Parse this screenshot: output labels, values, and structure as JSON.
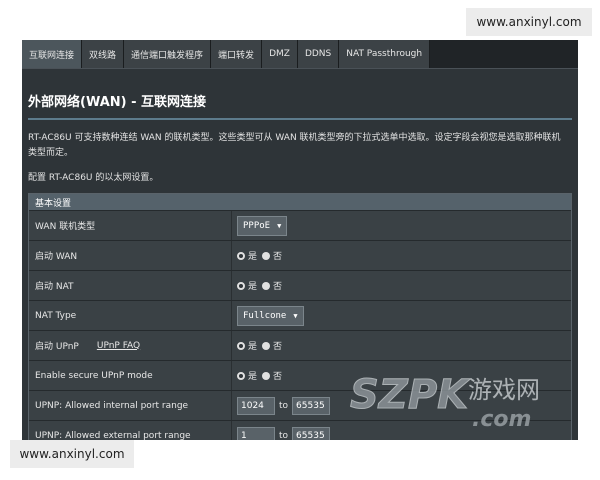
{
  "watermark_top": "www.anxinyl.com",
  "watermark_bottom": "www.anxinyl.com",
  "tabs": [
    "互联网连接",
    "双线路",
    "通信端口触发程序",
    "端口转发",
    "DMZ",
    "DDNS",
    "NAT Passthrough"
  ],
  "page_title": "外部网络(WAN) - 互联网连接",
  "description": "RT-AC86U 可支持数种连结 WAN 的联机类型。这些类型可从 WAN 联机类型旁的下拉式选单中选取。设定字段会视您是选取那种联机类型而定。",
  "config_text": "配置 RT-AC86U 的以太网设置。",
  "section_title": "基本设置",
  "rows": {
    "wan_type": {
      "label": "WAN 联机类型",
      "value": "PPPoE"
    },
    "enable_wan": {
      "label": "启动 WAN",
      "yes": "是",
      "no": "否"
    },
    "enable_nat": {
      "label": "启动 NAT",
      "yes": "是",
      "no": "否"
    },
    "nat_type": {
      "label": "NAT Type",
      "value": "Fullcone"
    },
    "enable_upnp": {
      "label": "启动 UPnP",
      "link": "UPnP FAQ",
      "yes": "是",
      "no": "否"
    },
    "secure_upnp": {
      "label": "Enable secure UPnP mode",
      "yes": "是",
      "no": "否"
    },
    "internal_range": {
      "label": "UPNP: Allowed internal port range",
      "from": "1024",
      "to_label": "to",
      "to": "65535"
    },
    "external_range": {
      "label": "UPNP: Allowed external port range",
      "from": "1",
      "to_label": "to",
      "to": "65535"
    }
  },
  "logo_text": {
    "main": "SZPK",
    "cn": "游戏网",
    "domain": ".com"
  },
  "colors": {
    "panel": "#2e3438",
    "section_head": "#55626b",
    "accent_rule": "#5d7b8c"
  }
}
